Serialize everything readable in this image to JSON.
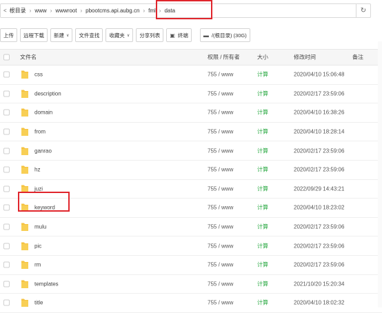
{
  "breadcrumb": {
    "back": "<",
    "items": [
      "根目录",
      "www",
      "wwwroot",
      "pbootcms.api.aubg.cn",
      "fml",
      "data"
    ],
    "refresh_icon": "refresh-icon"
  },
  "toolbar": {
    "upload": "上传",
    "remote_download": "远程下载",
    "new": "新建",
    "file_search": "文件查找",
    "favorites": "收藏夹",
    "share_list": "分享列表",
    "terminal": "终端",
    "disk": "/(根目录) (30G)"
  },
  "table": {
    "headers": {
      "name": "文件名",
      "perm": "权限 / 所有者",
      "size": "大小",
      "mtime": "修改时间",
      "note": "备注"
    },
    "rows": [
      {
        "name": "css",
        "perm": "755 / www",
        "size": "计算",
        "mtime": "2020/04/10 15:06:48"
      },
      {
        "name": "description",
        "perm": "755 / www",
        "size": "计算",
        "mtime": "2020/02/17 23:59:06"
      },
      {
        "name": "domain",
        "perm": "755 / www",
        "size": "计算",
        "mtime": "2020/04/10 16:38:26"
      },
      {
        "name": "from",
        "perm": "755 / www",
        "size": "计算",
        "mtime": "2020/04/10 18:28:14"
      },
      {
        "name": "ganrao",
        "perm": "755 / www",
        "size": "计算",
        "mtime": "2020/02/17 23:59:06"
      },
      {
        "name": "hz",
        "perm": "755 / www",
        "size": "计算",
        "mtime": "2020/02/17 23:59:06"
      },
      {
        "name": "juzi",
        "perm": "755 / www",
        "size": "计算",
        "mtime": "2022/09/29 14:43:21"
      },
      {
        "name": "keyword",
        "perm": "755 / www",
        "size": "计算",
        "mtime": "2020/04/10 18:23:02"
      },
      {
        "name": "mulu",
        "perm": "755 / www",
        "size": "计算",
        "mtime": "2020/02/17 23:59:06"
      },
      {
        "name": "pic",
        "perm": "755 / www",
        "size": "计算",
        "mtime": "2020/02/17 23:59:06"
      },
      {
        "name": "rm",
        "perm": "755 / www",
        "size": "计算",
        "mtime": "2020/02/17 23:59:06"
      },
      {
        "name": "templates",
        "perm": "755 / www",
        "size": "计算",
        "mtime": "2021/10/20 15:20:34"
      },
      {
        "name": "title",
        "perm": "755 / www",
        "size": "计算",
        "mtime": "2020/04/10 18:02:32"
      }
    ]
  },
  "colors": {
    "highlight": "#e0252c",
    "calc": "#20a53a",
    "folder": "#f5c342"
  }
}
